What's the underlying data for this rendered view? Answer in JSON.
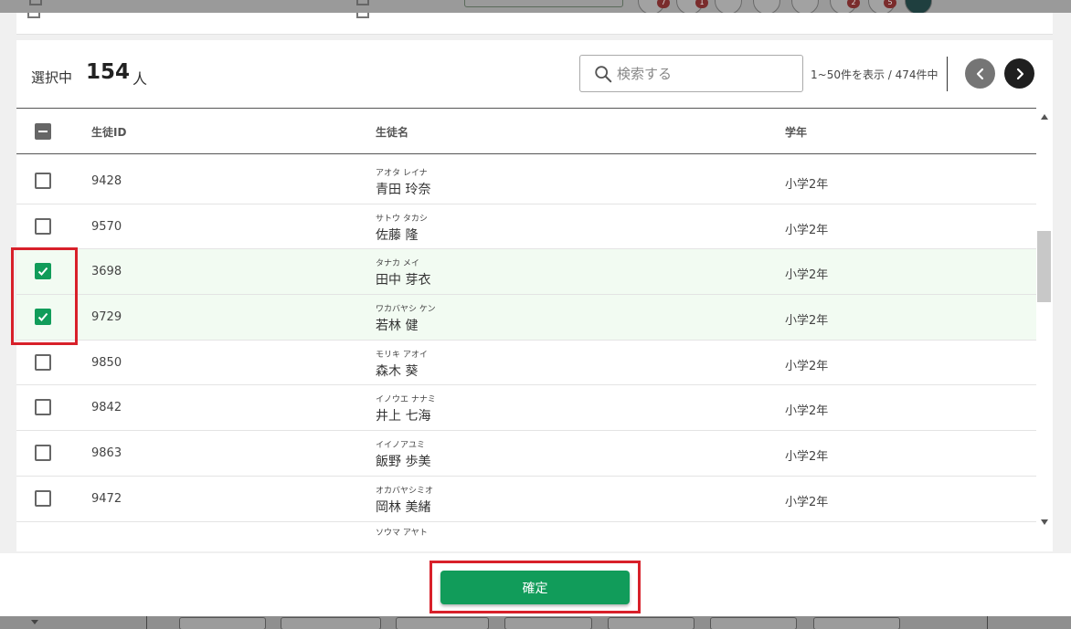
{
  "selection": {
    "label": "選択中",
    "count": "154",
    "unit": "人"
  },
  "search": {
    "placeholder": "検索する"
  },
  "pagination": {
    "range_text": "1~50件を表示 / 474件中"
  },
  "table": {
    "headers": {
      "student_id": "生徒ID",
      "student_name": "生徒名",
      "grade": "学年"
    },
    "rows": [
      {
        "id": "9428",
        "kana": "アオタ レイナ",
        "name": "青田 玲奈",
        "grade": "小学2年",
        "checked": false
      },
      {
        "id": "9570",
        "kana": "サトウ タカシ",
        "name": "佐藤 隆",
        "grade": "小学2年",
        "checked": false
      },
      {
        "id": "3698",
        "kana": "タナカ メイ",
        "name": "田中 芽衣",
        "grade": "小学2年",
        "checked": true
      },
      {
        "id": "9729",
        "kana": "ワカバヤシ ケン",
        "name": "若林 健",
        "grade": "小学2年",
        "checked": true
      },
      {
        "id": "9850",
        "kana": "モリキ アオイ",
        "name": "森木 葵",
        "grade": "小学2年",
        "checked": false
      },
      {
        "id": "9842",
        "kana": "イノウエ ナナミ",
        "name": "井上 七海",
        "grade": "小学2年",
        "checked": false
      },
      {
        "id": "9863",
        "kana": "イイノアユミ",
        "name": "飯野 歩美",
        "grade": "小学2年",
        "checked": false
      },
      {
        "id": "9472",
        "kana": "オカバヤシミオ",
        "name": "岡林 美緒",
        "grade": "小学2年",
        "checked": false
      }
    ],
    "partial_row": {
      "kana": "ソウマ アヤト"
    }
  },
  "footer": {
    "confirm_label": "確定"
  },
  "background": {
    "badges": [
      "7",
      "1",
      "2",
      "5"
    ]
  },
  "colors": {
    "accent": "#119c5a",
    "highlight": "#d8202a"
  }
}
